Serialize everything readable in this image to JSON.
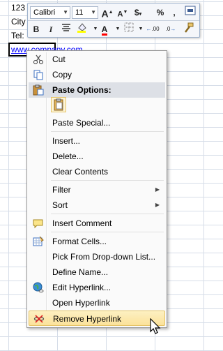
{
  "sheet": {
    "cells": [
      "123",
      "City",
      "Tel:",
      "www.company.com"
    ]
  },
  "mini_toolbar": {
    "font_name": "Calibri",
    "font_size": "11",
    "buttons": [
      "A",
      "A",
      "$",
      "%",
      ",",
      "B",
      "I",
      "A",
      ".00",
      ".0"
    ]
  },
  "menu": {
    "items": [
      {
        "label": "Cut",
        "icon": "scissors-icon"
      },
      {
        "label": "Copy",
        "icon": "copy-icon"
      },
      {
        "label": "Paste Options:",
        "icon": "clipboard-icon"
      },
      {
        "label": "Paste Special...",
        "icon": ""
      },
      {
        "label": "Insert...",
        "icon": ""
      },
      {
        "label": "Delete...",
        "icon": ""
      },
      {
        "label": "Clear Contents",
        "icon": ""
      },
      {
        "label": "Filter",
        "icon": ""
      },
      {
        "label": "Sort",
        "icon": ""
      },
      {
        "label": "Insert Comment",
        "icon": "comment-icon"
      },
      {
        "label": "Format Cells...",
        "icon": "format-cells-icon"
      },
      {
        "label": "Pick From Drop-down List...",
        "icon": ""
      },
      {
        "label": "Define Name...",
        "icon": ""
      },
      {
        "label": "Edit Hyperlink...",
        "icon": "globe-link-icon"
      },
      {
        "label": "Open Hyperlink",
        "icon": ""
      },
      {
        "label": "Remove Hyperlink",
        "icon": "remove-link-icon"
      }
    ]
  }
}
